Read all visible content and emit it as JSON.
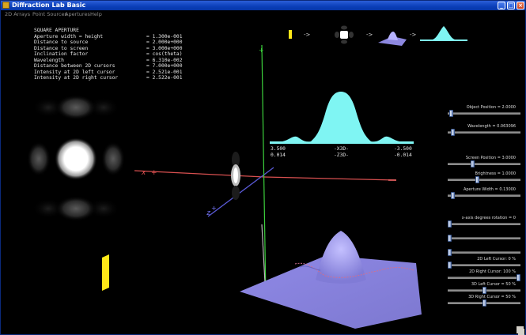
{
  "window": {
    "title": "Diffraction Lab Basic"
  },
  "menu": [
    "2D Arrays",
    "Point Sources",
    "Apertures",
    "Help"
  ],
  "info": {
    "heading": "SQUARE APERTURE",
    "rows": [
      {
        "key": "Aperture width = height",
        "value": "= 1.300e-001"
      },
      {
        "key": "Distance to source",
        "value": "= 2.000e+000"
      },
      {
        "key": "Distance to screen",
        "value": "= 3.000e+000"
      },
      {
        "key": "Inclination factor",
        "value": "= cos(theta)"
      },
      {
        "key": "Wavelength",
        "value": "= 6.310e-002"
      },
      {
        "key": "Distance between 2D cursors",
        "value": "= 7.000e+000"
      },
      {
        "key": "Intensity at 2D left cursor",
        "value": "= 2.521e-001"
      },
      {
        "key": "Intensity at 2D right cursor",
        "value": "= 2.522e-001"
      }
    ]
  },
  "coords": {
    "left_top": "3.500",
    "left_bottom": "0.014",
    "mid_top": "-X3D-",
    "mid_bottom": "-Z3D-",
    "right_top": "-3.500",
    "right_bottom": "-0.014"
  },
  "axes": {
    "x_label": "x",
    "z_label": "z"
  },
  "controls": [
    {
      "label": "Object Position = 2.0000",
      "level": 0.02
    },
    {
      "label": "Wavelength = 0.063096",
      "level": 0.05
    },
    {
      "label": "Screen Position = 3.0000",
      "level": 0.33
    },
    {
      "label": "Brightness = 1.0000",
      "level": 0.4
    },
    {
      "label": "Aperture Width = 0.13000",
      "level": 0.05
    },
    {
      "label": "x-axis degrees rotation = 0",
      "level": 0.0
    },
    {
      "label": "",
      "level": 0.0
    },
    {
      "label": "",
      "level": 0.0
    },
    {
      "label": "2D Left Cursor: 0 %",
      "level": 0.0
    },
    {
      "label": "2D Right Cursor: 100 %",
      "level": 1.0
    },
    {
      "label": "3D Left Cursor = 50 %",
      "level": 0.5
    },
    {
      "label": "3D Right Cursor = 50 %",
      "level": 0.5
    }
  ],
  "colors": {
    "cyan_plot": "#7ff5f3",
    "surface": "#8d88e0",
    "x_axis": "#d85050",
    "z_axis": "#5b5bd8",
    "y_axis": "#3cd03c",
    "aperture": "#ffe818"
  }
}
